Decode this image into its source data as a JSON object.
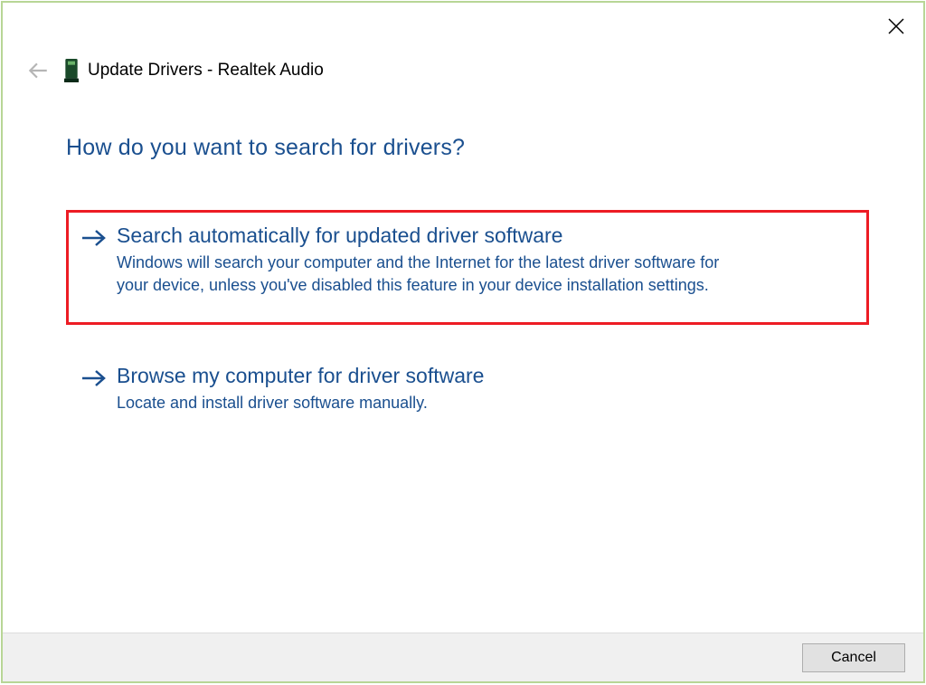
{
  "window": {
    "title": "Update Drivers - Realtek Audio"
  },
  "heading": "How do you want to search for drivers?",
  "options": [
    {
      "title": "Search automatically for updated driver software",
      "description": "Windows will search your computer and the Internet for the latest driver software for your device, unless you've disabled this feature in your device installation settings."
    },
    {
      "title": "Browse my computer for driver software",
      "description": "Locate and install driver software manually."
    }
  ],
  "footer": {
    "cancel_label": "Cancel"
  }
}
